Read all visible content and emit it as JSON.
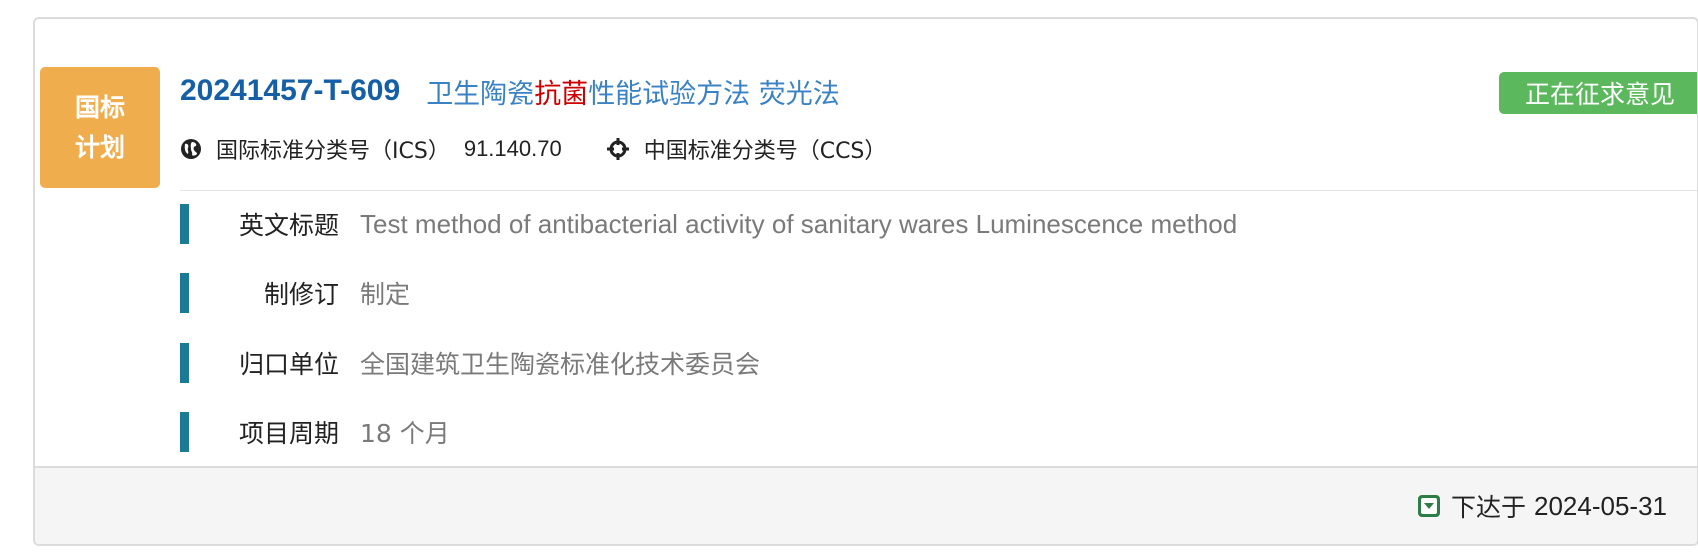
{
  "plan_badge": {
    "line1": "国标",
    "line2": "计划"
  },
  "standard": {
    "number": "20241457-T-609",
    "title_part1": "卫生陶瓷",
    "title_highlight": "抗菌",
    "title_part2": "性能试验方法 荧光法"
  },
  "status": {
    "label": "正在征求意见",
    "color": "#5cb85c"
  },
  "classification": {
    "ics_label": "国际标准分类号（ICS）",
    "ics_value": "91.140.70",
    "ics_icon": "globe-icon",
    "ccs_label": "中国标准分类号（CCS）",
    "ccs_value": "",
    "ccs_icon": "crosshair-icon"
  },
  "fields": [
    {
      "label": "英文标题",
      "value": "Test method of antibacterial activity of sanitary wares Luminescence method"
    },
    {
      "label": "制修订",
      "value": "制定"
    },
    {
      "label": "归口单位",
      "value": "全国建筑卫生陶瓷标准化技术委员会"
    },
    {
      "label": "项目周期",
      "value": "18 个月"
    }
  ],
  "footer": {
    "icon": "caret-down-square-icon",
    "label": "下达于",
    "date": "2024-05-31"
  },
  "colors": {
    "badge_orange": "#f0ad4e",
    "accent_blue": "#155fa6",
    "title_blue": "#3b82c4",
    "highlight_red": "#cc0000",
    "field_bar": "#1b7a94",
    "footer_icon_green": "#2e7d46"
  }
}
